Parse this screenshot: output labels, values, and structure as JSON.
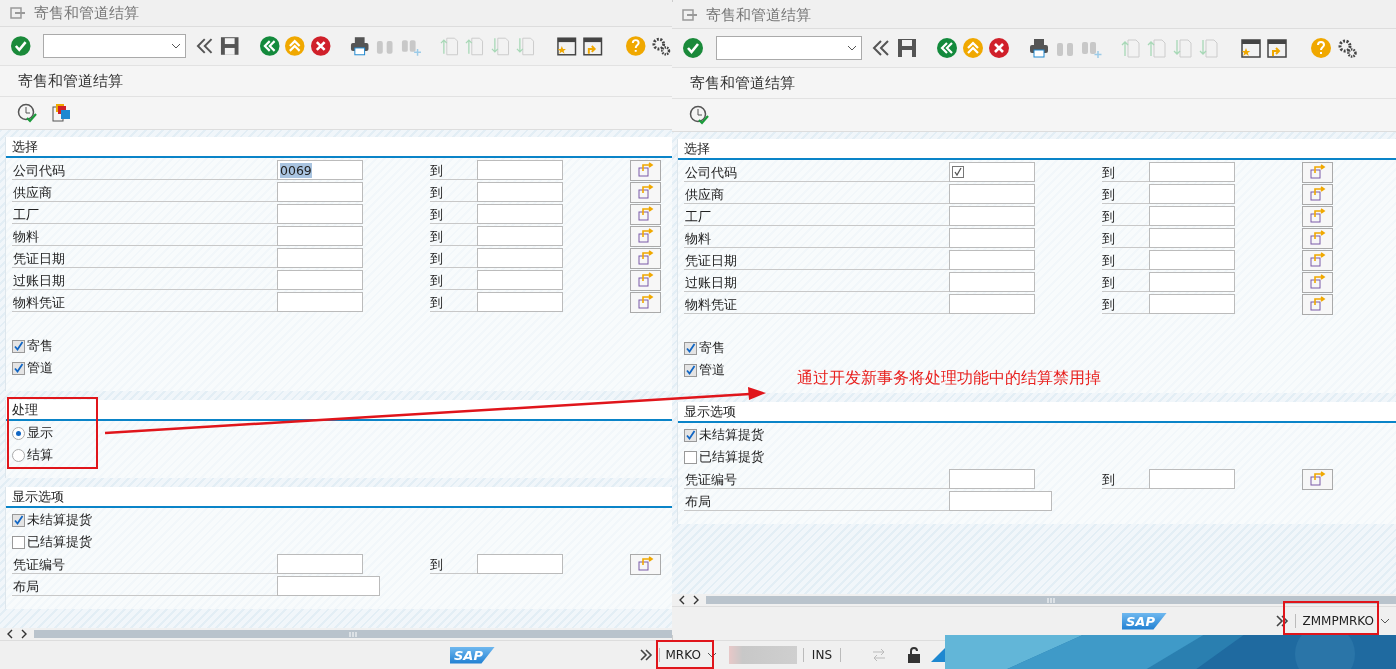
{
  "windows": [
    {
      "title": "寄售和管道结算",
      "screen_title": "寄售和管道结算",
      "app_toolbar": [
        {
          "kind": "execute"
        },
        {
          "kind": "layers"
        }
      ],
      "sections": [
        {
          "title": "选择",
          "items": [
            {
              "kind": "range",
              "label": "公司代码",
              "value": "0069",
              "highlighted": true,
              "to": "到"
            },
            {
              "kind": "range",
              "label": "供应商",
              "to": "到"
            },
            {
              "kind": "range",
              "label": "工厂",
              "to": "到"
            },
            {
              "kind": "range",
              "label": "物料",
              "to": "到"
            },
            {
              "kind": "range",
              "label": "凭证日期",
              "to": "到"
            },
            {
              "kind": "range",
              "label": "过账日期",
              "to": "到"
            },
            {
              "kind": "range",
              "label": "物料凭证",
              "to": "到"
            },
            {
              "kind": "checkbox",
              "label": "寄售",
              "checked": true
            },
            {
              "kind": "checkbox",
              "label": "管道",
              "checked": true
            }
          ]
        },
        {
          "title": "处理",
          "items": [
            {
              "kind": "radio",
              "label": "显示",
              "selected": true
            },
            {
              "kind": "radio",
              "label": "结算",
              "selected": false
            }
          ]
        },
        {
          "title": "显示选项",
          "items": [
            {
              "kind": "checkbox",
              "label": "未结算提货",
              "checked": true
            },
            {
              "kind": "checkbox",
              "label": "已结算提货",
              "checked": false
            },
            {
              "kind": "range",
              "label": "凭证编号",
              "to": "到"
            },
            {
              "kind": "single",
              "label": "布局"
            }
          ]
        }
      ],
      "status": {
        "logo": "SAP",
        "transaction": "MRKO",
        "mode": "INS"
      }
    },
    {
      "title": "寄售和管道结算",
      "screen_title": "寄售和管道结算",
      "app_toolbar": [
        {
          "kind": "execute"
        }
      ],
      "sections": [
        {
          "title": "选择",
          "items": [
            {
              "kind": "range",
              "label": "公司代码",
              "required": true,
              "to": "到"
            },
            {
              "kind": "range",
              "label": "供应商",
              "to": "到"
            },
            {
              "kind": "range",
              "label": "工厂",
              "to": "到"
            },
            {
              "kind": "range",
              "label": "物料",
              "to": "到"
            },
            {
              "kind": "range",
              "label": "凭证日期",
              "to": "到"
            },
            {
              "kind": "range",
              "label": "过账日期",
              "to": "到"
            },
            {
              "kind": "range",
              "label": "物料凭证",
              "to": "到"
            },
            {
              "kind": "checkbox",
              "label": "寄售",
              "checked": true
            },
            {
              "kind": "checkbox",
              "label": "管道",
              "checked": true
            }
          ]
        },
        {
          "title": "显示选项",
          "items": [
            {
              "kind": "checkbox",
              "label": "未结算提货",
              "checked": true
            },
            {
              "kind": "checkbox",
              "label": "已结算提货",
              "checked": false
            },
            {
              "kind": "range",
              "label": "凭证编号",
              "to": "到"
            },
            {
              "kind": "single",
              "label": "布局"
            }
          ]
        }
      ],
      "status": {
        "logo": "SAP",
        "transaction": "ZMMPMRKO"
      }
    }
  ],
  "annotation": {
    "note": "通过开发新事务将处理功能中的结算禁用掉"
  }
}
